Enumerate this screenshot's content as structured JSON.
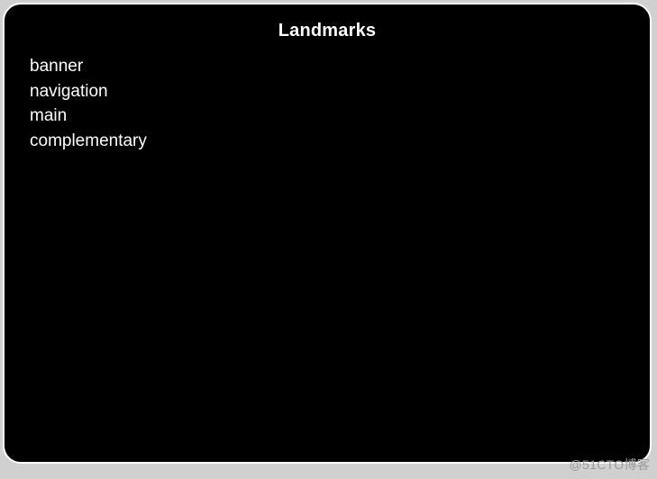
{
  "panel": {
    "title": "Landmarks",
    "items": [
      {
        "label": "banner"
      },
      {
        "label": "navigation"
      },
      {
        "label": "main"
      },
      {
        "label": "complementary"
      }
    ]
  },
  "watermark": "@51CTO博客"
}
